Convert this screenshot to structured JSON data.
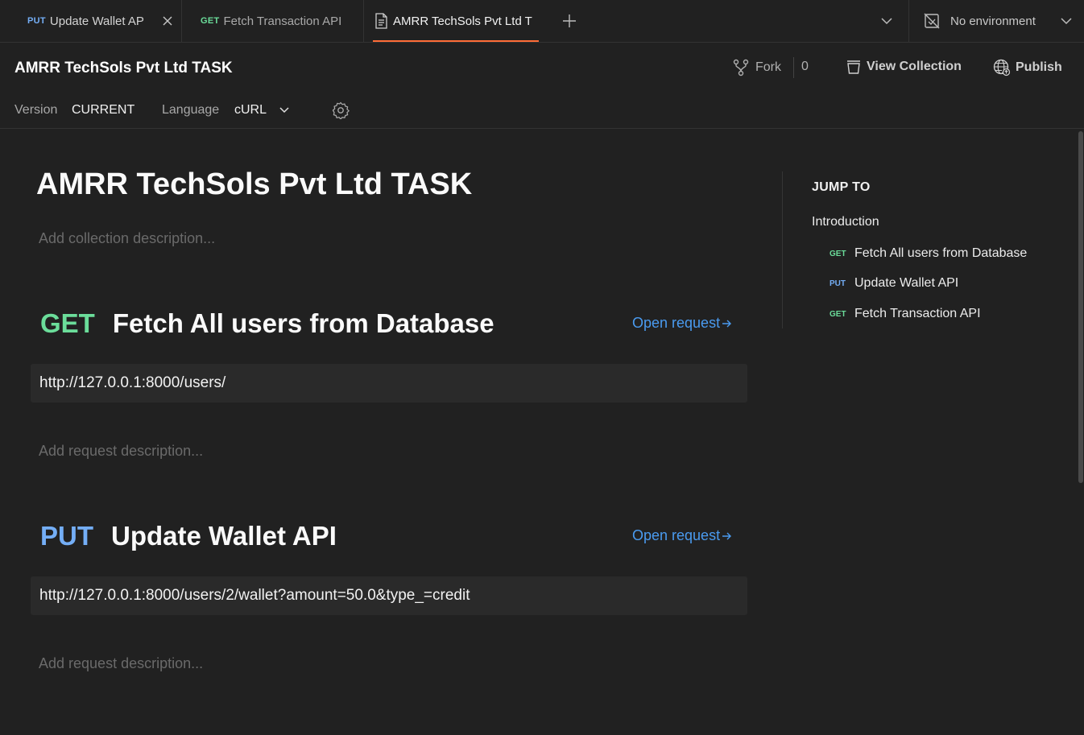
{
  "tabs": [
    {
      "method": "PUT",
      "label": "Update Wallet AP"
    },
    {
      "method": "GET",
      "label": "Fetch Transaction API"
    },
    {
      "label": "AMRR TechSols Pvt Ltd T"
    }
  ],
  "environment": {
    "label": "No environment"
  },
  "header": {
    "title": "AMRR TechSols Pvt Ltd TASK",
    "fork_label": "Fork",
    "fork_count": "0",
    "view_collection_label": "View Collection",
    "publish_label": "Publish",
    "version_label": "Version",
    "version_value": "CURRENT",
    "language_label": "Language",
    "language_value": "cURL"
  },
  "main": {
    "title": "AMRR TechSols Pvt Ltd TASK",
    "collection_description_placeholder": "Add collection description...",
    "requests": [
      {
        "method": "GET",
        "name": "Fetch All users from Database",
        "open_label": "Open request",
        "url": "http://127.0.0.1:8000/users/",
        "description_placeholder": "Add request description..."
      },
      {
        "method": "PUT",
        "name": "Update Wallet API",
        "open_label": "Open request",
        "url": "http://127.0.0.1:8000/users/2/wallet?amount=50.0&type_=credit",
        "description_placeholder": "Add request description..."
      }
    ]
  },
  "jump_to": {
    "title": "JUMP TO",
    "intro": "Introduction",
    "items": [
      {
        "method": "GET",
        "label": "Fetch All users from Database"
      },
      {
        "method": "PUT",
        "label": "Update Wallet API"
      },
      {
        "method": "GET",
        "label": "Fetch Transaction API"
      }
    ]
  },
  "colors": {
    "get": "#6bdd9a",
    "put": "#74aef6",
    "accent": "#ff6c37",
    "link": "#4a9bf0",
    "background": "#212121"
  },
  "icons": [
    "close-icon",
    "document-icon",
    "plus-icon",
    "chevron-down-icon",
    "no-environment-icon",
    "fork-icon",
    "view-collection-icon",
    "publish-globe-icon",
    "settings-gear-icon",
    "arrow-right-icon"
  ]
}
